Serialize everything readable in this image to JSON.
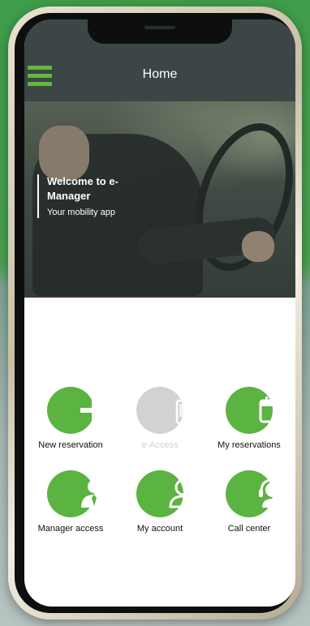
{
  "colors": {
    "accent": "#5bb342",
    "topbar": "#3c4646",
    "disabled": "#d2d2d2"
  },
  "header": {
    "title": "Home",
    "menu_icon": "hamburger-menu-icon"
  },
  "hero": {
    "title": "Welcome to e-Manager",
    "subtitle": "Your mobility app"
  },
  "tiles": [
    {
      "label": "New reservation",
      "icon": "plus-icon",
      "enabled": true
    },
    {
      "label": "e-Access",
      "icon": "phone-access-icon",
      "enabled": false
    },
    {
      "label": "My reservations",
      "icon": "calendar-icon",
      "enabled": true
    },
    {
      "label": "Manager access",
      "icon": "manager-icon",
      "enabled": true
    },
    {
      "label": "My account",
      "icon": "user-icon",
      "enabled": true
    },
    {
      "label": "Call center",
      "icon": "headset-icon",
      "enabled": true
    }
  ]
}
